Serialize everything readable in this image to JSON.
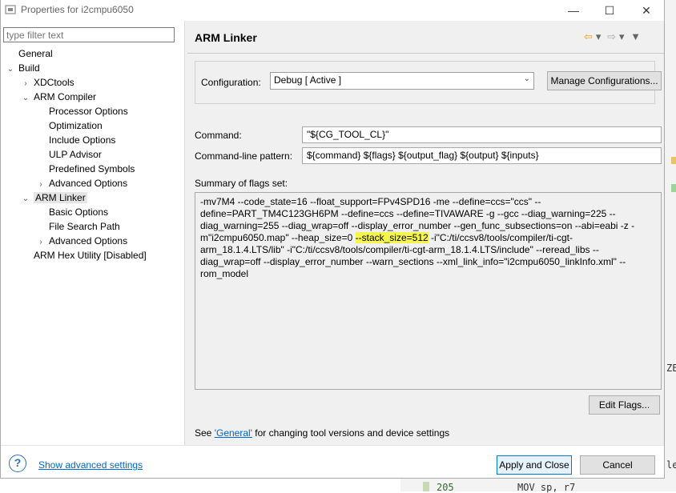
{
  "window": {
    "title": "Properties for i2cmpu6050",
    "minimize": "—",
    "maximize": "☐",
    "close": "✕"
  },
  "filter": {
    "placeholder": "type filter text"
  },
  "tree": [
    {
      "label": "General",
      "toggle": "",
      "depth": 0
    },
    {
      "label": "Build",
      "toggle": "⌄",
      "depth": 0
    },
    {
      "label": "XDCtools",
      "toggle": "›",
      "depth": 1
    },
    {
      "label": "ARM Compiler",
      "toggle": "⌄",
      "depth": 1
    },
    {
      "label": "Processor Options",
      "toggle": "",
      "depth": 2
    },
    {
      "label": "Optimization",
      "toggle": "",
      "depth": 2
    },
    {
      "label": "Include Options",
      "toggle": "",
      "depth": 2
    },
    {
      "label": "ULP Advisor",
      "toggle": "",
      "depth": 2
    },
    {
      "label": "Predefined Symbols",
      "toggle": "",
      "depth": 2
    },
    {
      "label": "Advanced Options",
      "toggle": "›",
      "depth": 2
    },
    {
      "label": "ARM Linker",
      "toggle": "⌄",
      "depth": 1,
      "selected": true
    },
    {
      "label": "Basic Options",
      "toggle": "",
      "depth": 2
    },
    {
      "label": "File Search Path",
      "toggle": "",
      "depth": 2
    },
    {
      "label": "Advanced Options",
      "toggle": "›",
      "depth": 2
    },
    {
      "label": "ARM Hex Utility  [Disabled]",
      "toggle": "",
      "depth": 1
    }
  ],
  "page": {
    "title": "ARM Linker",
    "configuration_label": "Configuration:",
    "configuration_value": "Debug  [ Active ]",
    "manage_button": "Manage Configurations...",
    "command_label": "Command:",
    "command_value": "\"${CG_TOOL_CL}\"",
    "pattern_label": "Command-line pattern:",
    "pattern_value": "${command} ${flags} ${output_flag} ${output} ${inputs}",
    "summary_label": "Summary of flags set:",
    "summary_before": "-mv7M4 --code_state=16 --float_support=FPv4SPD16 -me --define=ccs=\"ccs\" --define=PART_TM4C123GH6PM --define=ccs --define=TIVAWARE -g --gcc --diag_warning=225 --diag_warning=255 --diag_wrap=off --display_error_number --gen_func_subsections=on --abi=eabi -z -m\"i2cmpu6050.map\" --heap_size=0 ",
    "summary_highlight": "--stack_size=512",
    "summary_after": " -i\"C:/ti/ccsv8/tools/compiler/ti-cgt-arm_18.1.4.LTS/lib\" -i\"C:/ti/ccsv8/tools/compiler/ti-cgt-arm_18.1.4.LTS/include\" --reread_libs --diag_wrap=off --display_error_number --warn_sections --xml_link_info=\"i2cmpu6050_linkInfo.xml\" --rom_model",
    "edit_flags_button": "Edit Flags...",
    "see_prefix": "See ",
    "see_link": "'General'",
    "see_suffix": " for changing tool versions and device settings"
  },
  "footer": {
    "help": "?",
    "advanced_link": "Show advanced settings",
    "apply_close": "Apply and Close",
    "cancel": "Cancel"
  },
  "background": {
    "frag_ze": "ZE",
    "frag_le": "le",
    "line_number": "205",
    "code": "MOV sp, r7"
  }
}
